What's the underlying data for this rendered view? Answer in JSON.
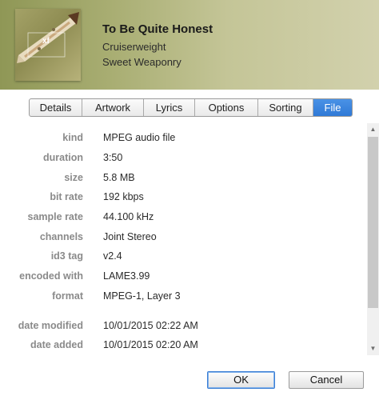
{
  "header": {
    "title": "To Be Quite Honest",
    "artist": "Cruiserweight",
    "album": "Sweet Weaponry"
  },
  "tabs": [
    {
      "label": "Details",
      "active": false
    },
    {
      "label": "Artwork",
      "active": false
    },
    {
      "label": "Lyrics",
      "active": false
    },
    {
      "label": "Options",
      "active": false
    },
    {
      "label": "Sorting",
      "active": false
    },
    {
      "label": "File",
      "active": true
    }
  ],
  "file_info": [
    {
      "label": "kind",
      "value": "MPEG audio file"
    },
    {
      "label": "duration",
      "value": "3:50"
    },
    {
      "label": "size",
      "value": "5.8 MB"
    },
    {
      "label": "bit rate",
      "value": "192 kbps"
    },
    {
      "label": "sample rate",
      "value": "44.100 kHz"
    },
    {
      "label": "channels",
      "value": "Joint Stereo"
    },
    {
      "label": "id3 tag",
      "value": "v2.4"
    },
    {
      "label": "encoded with",
      "value": "LAME3.99"
    },
    {
      "label": "format",
      "value": "MPEG-1, Layer 3"
    },
    {
      "label": "date modified",
      "value": "10/01/2015 02:22 AM"
    },
    {
      "label": "date added",
      "value": "10/01/2015 02:20 AM"
    }
  ],
  "buttons": {
    "ok_label": "OK",
    "cancel_label": "Cancel"
  },
  "icons": {
    "scroll_up": "scroll-up-arrow-icon",
    "scroll_down": "scroll-down-arrow-icon"
  },
  "colors": {
    "active_tab": "#3a84de",
    "label_text": "#8a8a8a"
  }
}
